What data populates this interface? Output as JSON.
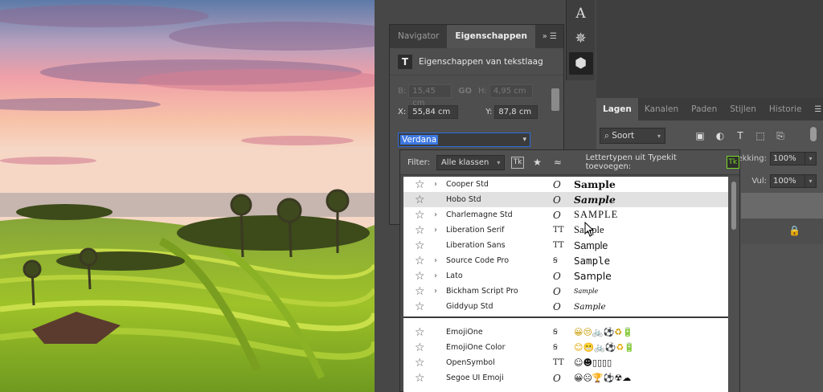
{
  "tools": [
    {
      "icon": "text-path-icon",
      "glyph": "A"
    },
    {
      "icon": "gear-icon",
      "glyph": "✵"
    },
    {
      "icon": "cube-icon",
      "glyph": "⬢"
    }
  ],
  "properties_panel": {
    "tabs": [
      "Navigator",
      "Eigenschappen"
    ],
    "title": "Eigenschappen van tekstlaag",
    "w_label": "B:",
    "w_value": "15,45 cm",
    "link_label": "GO",
    "h_label": "H:",
    "h_value": "4,95 cm",
    "x_label": "X:",
    "x_value": "55,84 cm",
    "y_label": "Y:",
    "y_value": "87,8 cm",
    "font_value": "Verdana"
  },
  "layers_panel": {
    "tabs": [
      "Lagen",
      "Kanalen",
      "Paden",
      "Stijlen",
      "Historie"
    ],
    "filter_label": "Soort",
    "opacity_label": "Dekking:",
    "opacity_value": "100%",
    "fill_label": "Vul:",
    "fill_value": "100%"
  },
  "font_picker": {
    "filter_label": "Filter:",
    "filter_value": "Alle klassen",
    "typekit_label": "Lettertypen uit Typekit toevoegen:",
    "fonts": [
      {
        "name": "Cooper Std",
        "expand": true,
        "type": "O",
        "sample": "Sample"
      },
      {
        "name": "Hobo Std",
        "expand": false,
        "type": "O",
        "sample": "Sample"
      },
      {
        "name": "Charlemagne Std",
        "expand": true,
        "type": "O",
        "sample": "SAMPLE"
      },
      {
        "name": "Liberation Serif",
        "expand": true,
        "type": "TT",
        "sample": "Sample"
      },
      {
        "name": "Liberation Sans",
        "expand": false,
        "type": "TT",
        "sample": "Sample"
      },
      {
        "name": "Source Code Pro",
        "expand": true,
        "type": "SVG",
        "sample": "Sample"
      },
      {
        "name": "Lato",
        "expand": true,
        "type": "O",
        "sample": "Sample"
      },
      {
        "name": "Bickham Script Pro",
        "expand": true,
        "type": "O",
        "sample": "Sample"
      },
      {
        "name": "Giddyup Std",
        "expand": false,
        "type": "O",
        "sample": "Sample"
      }
    ],
    "emoji_fonts": [
      {
        "name": "EmojiOne",
        "type": "SVG",
        "sample": "😀😒🚲⚽♻🔋"
      },
      {
        "name": "EmojiOne Color",
        "type": "SVG",
        "sample": "😊😬🚲⚽♻🔋"
      },
      {
        "name": "OpenSymbol",
        "type": "TT",
        "sample": "☺☻▯▯▯▯"
      },
      {
        "name": "Segoe UI Emoji",
        "type": "O",
        "sample": "😀☹🏆⚽☢☁"
      }
    ]
  }
}
